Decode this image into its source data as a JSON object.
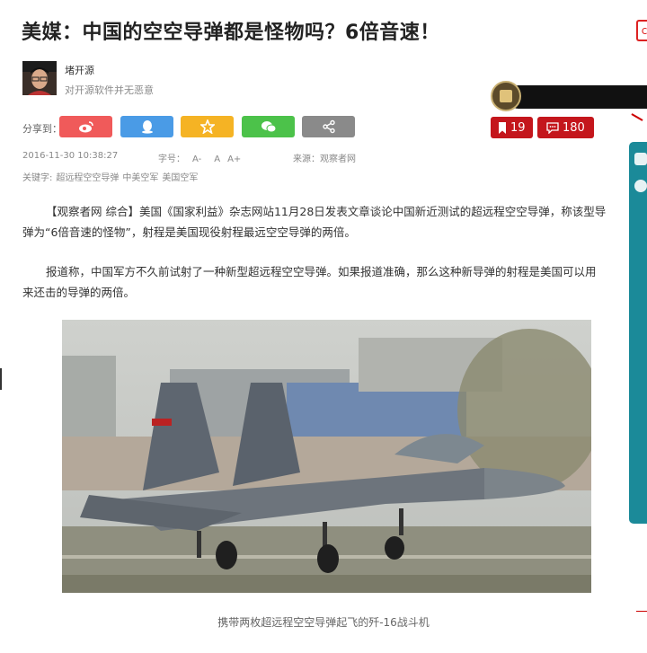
{
  "article": {
    "title": "美媒：中国的空空导弹都是怪物吗？6倍音速！",
    "author": {
      "name": "堵开源",
      "description": "对开源软件并无恶意"
    },
    "share_label": "分享到：",
    "share_buttons": [
      {
        "name": "weibo",
        "icon": "weibo-icon",
        "color": "#f05a5a"
      },
      {
        "name": "qq",
        "icon": "qq-penguin-icon",
        "color": "#4a9be6"
      },
      {
        "name": "favorite",
        "icon": "star-icon",
        "color": "#f5b324"
      },
      {
        "name": "wechat",
        "icon": "wechat-icon",
        "color": "#4cc24a"
      },
      {
        "name": "more",
        "icon": "share-nodes-icon",
        "color": "#8a8a8a"
      }
    ],
    "bookmark_count": "19",
    "comment_count": "180",
    "datetime": "2016-11-30 10:38:27",
    "font_size": {
      "label": "字号：",
      "small": "A-",
      "normal": "A",
      "large": "A+"
    },
    "source": "来源：观察者网",
    "keywords_label": "关键字:",
    "keywords": [
      "超远程空空导弹",
      "中美空军",
      "美国空军"
    ],
    "paragraph1": "【观察者网 综合】美国《国家利益》杂志网站11月28日发表文章谈论中国新近测试的超远程空空导弹，称该型导弹为“6倍音速的怪物”，射程是美国现役射程最远空空导弹的两倍。",
    "paragraph2": "报道称，中国军方不久前试射了一种新型超远程空空导弹。如果报道准确，那么这种新导弹的射程是美国可以用来还击的导弹的两倍。",
    "image_caption": "携带两枚超远程空空导弹起飞的歼-16战斗机"
  },
  "colors": {
    "accent_red": "#c4161c",
    "side_panel": "#1b8a99"
  }
}
